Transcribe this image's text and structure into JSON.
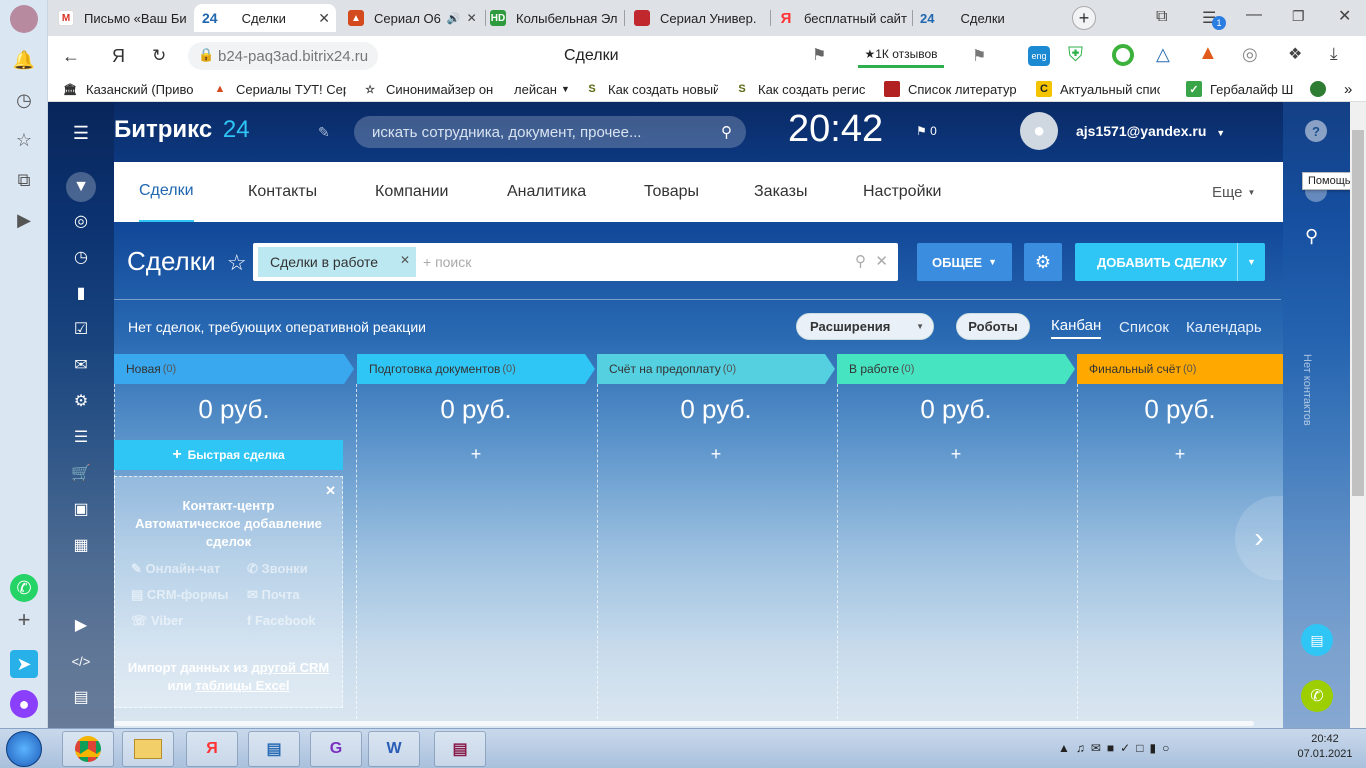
{
  "browser": {
    "tabs": [
      {
        "title": "Письмо «Ваш Би",
        "icon": "gmail-icon",
        "color": "#d93025",
        "active": false
      },
      {
        "title": "Сделки",
        "icon": "bitrix24-icon",
        "color": "#2fc6f6",
        "active": true
      },
      {
        "title": "Сериал О6",
        "icon": "fire-icon",
        "color": "#d24a1e",
        "active": false
      },
      {
        "title": "Колыбельная Эл",
        "icon": "hd-icon",
        "color": "#2e9b3e",
        "active": false
      },
      {
        "title": "Сериал Универ.",
        "icon": "book-icon",
        "color": "#c0282d",
        "active": false
      },
      {
        "title": "бесплатный сайт",
        "icon": "yandex-icon",
        "color": "#f33",
        "active": false
      },
      {
        "title": "Сделки",
        "icon": "bitrix24-icon",
        "color": "#2fc6f6",
        "active": false
      }
    ],
    "tab_prefix_24": "24",
    "new_tab": "+",
    "url": "b24-paq3ad.bitrix24.ru",
    "page_title": "Сделки",
    "reviews_badge": "1К отзывов",
    "notif_count": "1",
    "yandex_logo": "Я",
    "bookmarks": [
      {
        "label": "Казанский (Приво",
        "icon": "bank-icon"
      },
      {
        "label": "Сериалы ТУТ! Сер",
        "icon": "fire-icon"
      },
      {
        "label": "Синонимайзер он",
        "icon": "star-icon"
      },
      {
        "label": "лейсан",
        "icon": "folder-icon"
      },
      {
        "label": "Как создать новый",
        "icon": "s-icon"
      },
      {
        "label": "Как создать регис",
        "icon": "s-icon"
      },
      {
        "label": "Список литератур",
        "icon": "book-icon"
      },
      {
        "label": "Актуальный списс",
        "icon": "c-icon"
      },
      {
        "label": "Гербалайф Ш",
        "icon": "herbalife-icon"
      }
    ],
    "more_bookmarks": "»"
  },
  "bitrix": {
    "logo_text": "Битрикс",
    "logo_num": "24",
    "search_placeholder": "искать сотрудника, документ, прочее...",
    "clock": "20:42",
    "flag_count": "0",
    "user_email": "ajs1571@yandex.ru",
    "help_tooltip": "Помощь",
    "right_panel_label": "Нет контактов",
    "nav": [
      "Сделки",
      "Контакты",
      "Компании",
      "Аналитика",
      "Товары",
      "Заказы",
      "Настройки"
    ],
    "nav_more": "Еще",
    "page_header": "Сделки",
    "filter_tag": "Сделки в работе",
    "filter_placeholder": "+ поиск",
    "btn_general": "ОБЩЕЕ",
    "btn_add_deal": "ДОБАВИТЬ СДЕЛКУ",
    "no_deals_text": "Нет сделок, требующих оперативной реакции",
    "btn_extensions": "Расширения",
    "btn_robots": "Роботы",
    "views": [
      "Канбан",
      "Список",
      "Календарь"
    ],
    "stages": [
      {
        "name": "Новая",
        "count": "(0)",
        "color": "#39a8ef",
        "sum": "0 руб."
      },
      {
        "name": "Подготовка документов",
        "count": "(0)",
        "color": "#2fc6f6",
        "sum": "0 руб."
      },
      {
        "name": "Счёт на предоплату",
        "count": "(0)",
        "color": "#55d0e0",
        "sum": "0 руб."
      },
      {
        "name": "В работе",
        "count": "(0)",
        "color": "#47e4c2",
        "sum": "0 руб."
      },
      {
        "name": "Финальный счёт",
        "count": "(0)",
        "color": "#ffa900",
        "sum": "0 руб."
      }
    ],
    "quick_deal": "Быстрая сделка",
    "plus": "+",
    "contact_center": {
      "title_line1": "Контакт-центр",
      "title_line2": "Автоматическое добавление",
      "title_line3": "сделок",
      "items": [
        "Онлайн-чат",
        "Звонки",
        "CRM-формы",
        "Почта",
        "Viber",
        "Facebook"
      ],
      "import_text": "Импорт данных из",
      "import_link1": "другой CRM",
      "or_text": "или",
      "import_link2": "таблицы Excel"
    }
  },
  "taskbar": {
    "time": "20:42",
    "date": "07.01.2021"
  }
}
